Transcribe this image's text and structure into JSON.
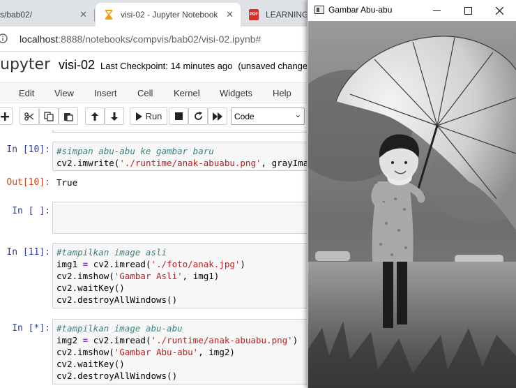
{
  "browser": {
    "tabs": [
      {
        "title": "s/bab02/"
      },
      {
        "title": "visi-02 - Jupyter Notebook"
      },
      {
        "title": "LEARNING_"
      }
    ],
    "url_host": "localhost",
    "url_path": ":8888/notebooks/compvis/bab02/visi-02.ipynb#"
  },
  "header": {
    "logo": "upyter",
    "notebook_name": "visi-02",
    "checkpoint": "Last Checkpoint: 14 minutes ago",
    "unsaved": "(unsaved changes"
  },
  "menu": [
    "Edit",
    "View",
    "Insert",
    "Cell",
    "Kernel",
    "Widgets",
    "Help"
  ],
  "toolbar": {
    "run_label": "Run",
    "cell_type": "Code"
  },
  "cells": [
    {
      "prompt": "In [10]:",
      "lines": [
        {
          "comment": "#simpan abu-abu ke gambar baru"
        },
        {
          "a": "cv2.imwrite(",
          "s": "'./runtime/anak-abuabu.png'",
          "b": ", grayIma"
        }
      ],
      "out_prompt": "Out[10]:",
      "output": "True"
    },
    {
      "prompt": "In [ ]:",
      "lines": []
    },
    {
      "prompt": "In [11]:",
      "lines": [
        {
          "comment": "#tampilkan image asli"
        },
        {
          "a": "img1 ",
          "op": "=",
          "b": " cv2.imread(",
          "s": "'./foto/anak.jpg'",
          "c": ")"
        },
        {
          "a": "cv2.imshow(",
          "s": "'Gambar Asli'",
          "b": ", img1)"
        },
        {
          "a": "cv2.waitKey()"
        },
        {
          "a": "cv2.destroyAllWindows()"
        }
      ]
    },
    {
      "prompt": "In [*]:",
      "lines": [
        {
          "comment": "#tampilkan image abu-abu"
        },
        {
          "a": "img2 ",
          "op": "=",
          "b": " cv2.imread(",
          "s": "'./runtime/anak-abuabu.png'",
          "c": ")"
        },
        {
          "a": "cv2.imshow(",
          "s": "'Gambar Abu-abu'",
          "b": ", img2)"
        },
        {
          "a": "cv2.waitKey()"
        },
        {
          "a": "cv2.destroyAllWindows()"
        }
      ]
    }
  ],
  "image_window": {
    "title": "Gambar Abu-abu"
  }
}
